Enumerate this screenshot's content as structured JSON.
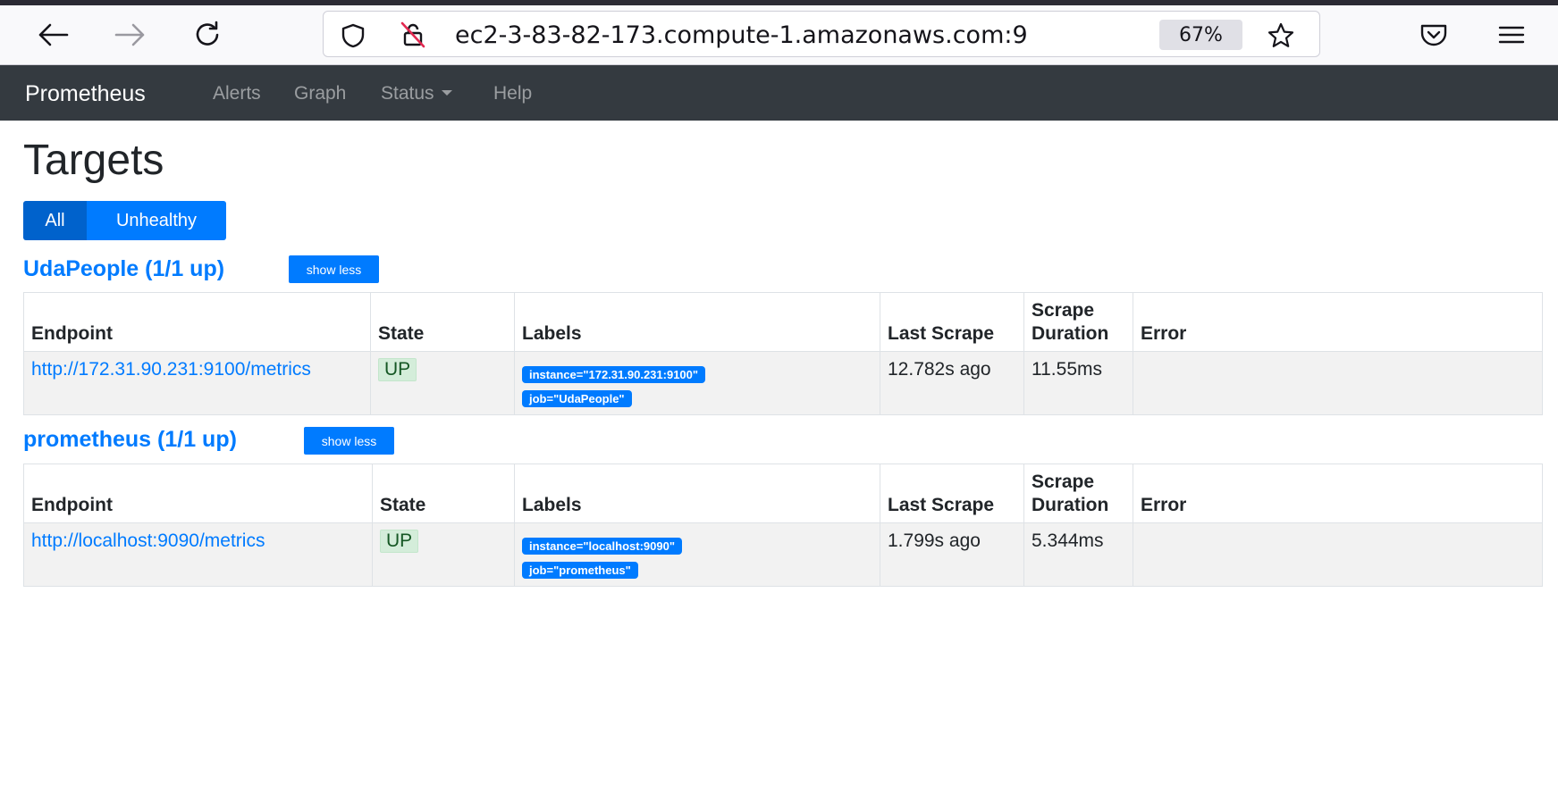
{
  "browser": {
    "url": "ec2-3-83-82-173.compute-1.amazonaws.com:9",
    "zoom": "67%"
  },
  "navbar": {
    "brand": "Prometheus",
    "links": [
      "Alerts",
      "Graph",
      "Status",
      "Help"
    ]
  },
  "page": {
    "title": "Targets",
    "filters": {
      "all": "All",
      "unhealthy": "Unhealthy"
    }
  },
  "columns": {
    "endpoint": "Endpoint",
    "state": "State",
    "labels": "Labels",
    "last_scrape": "Last Scrape",
    "scrape_duration": "Scrape Duration",
    "error": "Error"
  },
  "groups": [
    {
      "title": "UdaPeople (1/1 up)",
      "toggle": "show less",
      "rows": [
        {
          "endpoint": "http://172.31.90.231:9100/metrics",
          "state": "UP",
          "labels": [
            "instance=\"172.31.90.231:9100\"",
            "job=\"UdaPeople\""
          ],
          "last_scrape": "12.782s ago",
          "scrape_duration": "11.55ms",
          "error": ""
        }
      ]
    },
    {
      "title": "prometheus (1/1 up)",
      "toggle": "show less",
      "rows": [
        {
          "endpoint": "http://localhost:9090/metrics",
          "state": "UP",
          "labels": [
            "instance=\"localhost:9090\"",
            "job=\"prometheus\""
          ],
          "last_scrape": "1.799s ago",
          "scrape_duration": "5.344ms",
          "error": ""
        }
      ]
    }
  ]
}
